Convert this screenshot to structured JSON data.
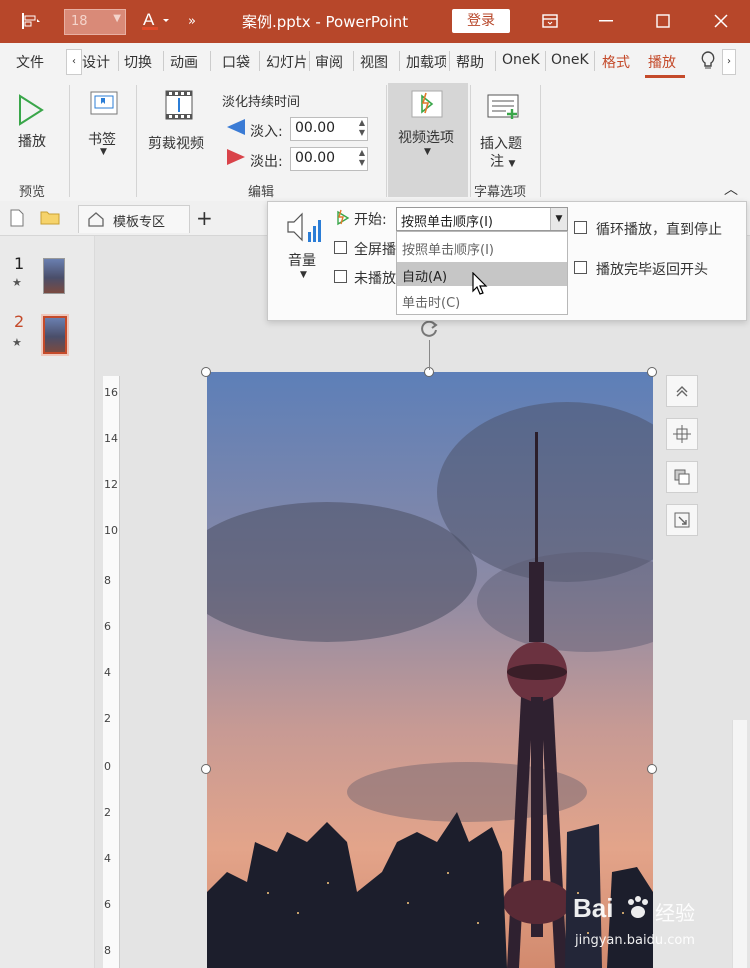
{
  "title_bar": {
    "font_size_value": "18",
    "doc_title": "案例.pptx  -  PowerPoint",
    "login_label": "登录",
    "accent_color": "#b7472a"
  },
  "tabs": [
    "文件",
    "设计",
    "切换",
    "动画",
    "口袋",
    "幻灯片",
    "审阅",
    "视图",
    "加载项",
    "帮助",
    "OneK",
    "OneK",
    "格式",
    "播放"
  ],
  "ribbon": {
    "play_label": "播放",
    "bookmark_label": "书签",
    "trim_label": "剪裁视频",
    "fade_title": "淡化持续时间",
    "fade_in_label": "淡入:",
    "fade_in_value": "00.00",
    "fade_out_label": "淡出:",
    "fade_out_value": "00.00",
    "video_options_label": "视频选项",
    "insert_caption_label": "插入题",
    "insert_caption_label2": "注",
    "groups": {
      "preview": "预览",
      "edit": "编辑",
      "captions": "字幕选项"
    }
  },
  "quickbar": {
    "template_tab": "模板专区",
    "ruler_text": "8"
  },
  "slides": [
    {
      "number": "1",
      "star": "★"
    },
    {
      "number": "2",
      "star": "★"
    }
  ],
  "panel": {
    "volume_label": "音量",
    "start_label": "开始:",
    "start_value": "按照单击顺序(I)",
    "fullscreen_label": "全屏播",
    "hide_label": "未播放",
    "loop_label": "循环播放，直到停止",
    "rewind_label": "播放完毕返回开头",
    "dropdown_options": [
      {
        "label": "按照单击顺序(I)",
        "highlighted": false
      },
      {
        "label": "自动(A)",
        "highlighted": true
      },
      {
        "label": "单击时(C)",
        "highlighted": false
      }
    ]
  },
  "ruler_v_labels": [
    "16",
    "14",
    "12",
    "10",
    "8",
    "6",
    "4",
    "2",
    "0",
    "2",
    "4",
    "6",
    "8"
  ],
  "watermark": {
    "brand": "Bai",
    "brand_cn": "经验",
    "url": "jingyan.baidu.com"
  }
}
